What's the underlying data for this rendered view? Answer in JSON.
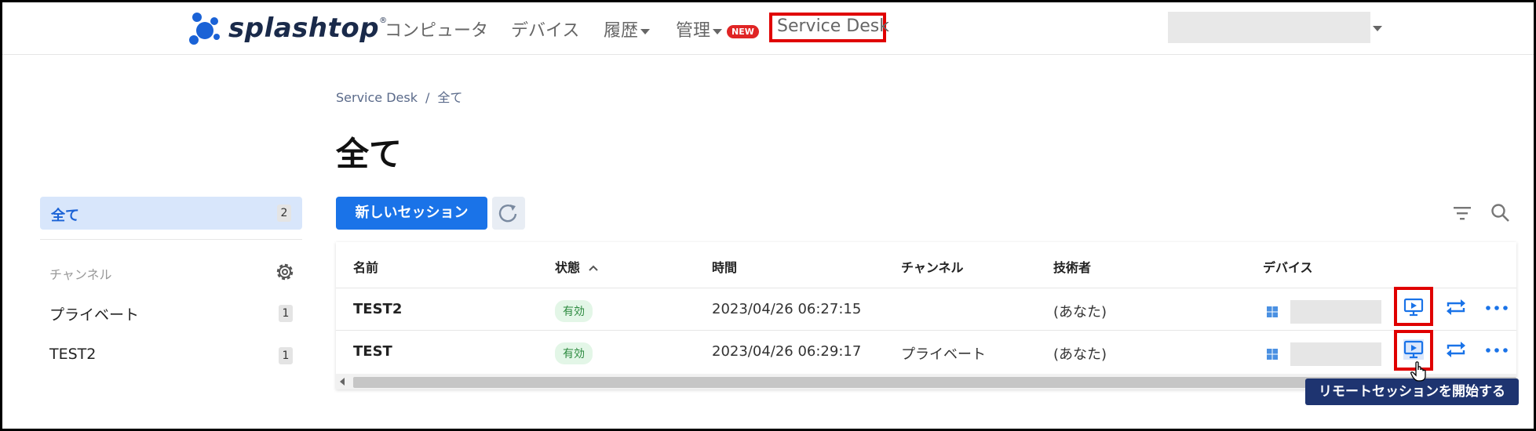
{
  "header": {
    "logo_text": "splashtop",
    "logo_reg": "®",
    "nav": {
      "computers": "コンピュータ",
      "devices": "デバイス",
      "history": "履歴",
      "management": "管理",
      "new_badge": "NEW",
      "service_desk": "Service Desk"
    }
  },
  "breadcrumb": {
    "root": "Service Desk",
    "sep": "/",
    "current": "全て"
  },
  "page_title": "全て",
  "sidebar": {
    "all_label": "全て",
    "all_count": "2",
    "channel_heading": "チャンネル",
    "channels": [
      {
        "label": "プライベート",
        "count": "1"
      },
      {
        "label": "TEST2",
        "count": "1"
      }
    ]
  },
  "toolbar": {
    "new_session_label": "新しいセッション"
  },
  "table": {
    "headers": {
      "name": "名前",
      "status": "状態",
      "time": "時間",
      "channel": "チャンネル",
      "technician": "技術者",
      "device": "デバイス"
    },
    "rows": [
      {
        "name": "TEST2",
        "status": "有効",
        "time": "2023/04/26 06:27:15",
        "channel": "",
        "technician": "(あなた)"
      },
      {
        "name": "TEST",
        "status": "有効",
        "time": "2023/04/26 06:29:17",
        "channel": "プライベート",
        "technician": "(あなた)"
      }
    ]
  },
  "tooltip": "リモートセッションを開始する",
  "colors": {
    "accent": "#1a73e8",
    "highlight": "#e00000",
    "tooltip_bg": "#1e3470",
    "status_green": "#2c8a3f"
  }
}
